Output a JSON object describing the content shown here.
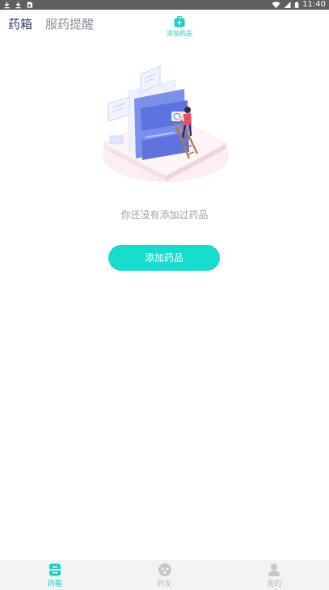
{
  "status_bar": {
    "time": "11:40",
    "icons": [
      "download-icon",
      "download-icon",
      "sim-icon",
      "wifi-icon",
      "signal-icon",
      "battery-icon"
    ]
  },
  "header": {
    "tabs": [
      {
        "label": "药箱",
        "active": true
      },
      {
        "label": "服药提醒",
        "active": false
      }
    ],
    "add_action": {
      "label": "添加药品",
      "icon": "add-medicine-icon"
    }
  },
  "main": {
    "empty_message": "你还没有添加过药品",
    "add_button_label": "添加药品",
    "illustration": "empty-medicine-box-illustration"
  },
  "bottom_nav": {
    "items": [
      {
        "label": "药箱",
        "icon": "medicine-box-icon",
        "active": true
      },
      {
        "label": "药友",
        "icon": "community-icon",
        "active": false
      },
      {
        "label": "我的",
        "icon": "profile-icon",
        "active": false
      }
    ]
  },
  "colors": {
    "accent": "#15dccb",
    "accent_text": "#1ccfbf",
    "tab_active": "#2d3e63",
    "tab_inactive": "#8a8f99",
    "muted_text": "#a0a4ab",
    "nav_background": "#f2f2f2"
  }
}
